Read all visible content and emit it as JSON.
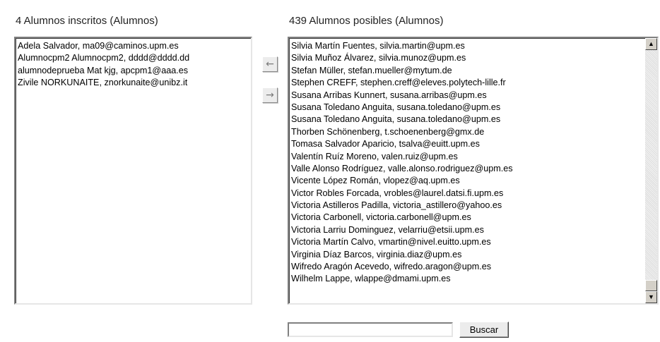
{
  "enrolled": {
    "heading": "4 Alumnos inscritos (Alumnos)",
    "items": [
      "Adela Salvador, ma09@caminos.upm.es",
      "Alumnocpm2 Alumnocpm2, dddd@dddd.dd",
      "alumnodeprueba Mat kjg, apcpm1@aaa.es",
      "Zivile NORKUNAITE, znorkunaite@unibz.it"
    ]
  },
  "candidates": {
    "heading": "439 Alumnos posibles (Alumnos)",
    "items": [
      "Silvia Martín Fuentes, silvia.martin@upm.es",
      "Silvia Muñoz Álvarez, silvia.munoz@upm.es",
      "Stefan Müller, stefan.mueller@mytum.de",
      "Stephen CREFF, stephen.creff@eleves.polytech-lille.fr",
      "Susana Arribas Kunnert, susana.arribas@upm.es",
      "Susana Toledano Anguita, susana.toledano@upm.es",
      "Susana Toledano Anguita, susana.toledano@upm.es",
      "Thorben Schönenberg, t.schoenenberg@gmx.de",
      "Tomasa Salvador Aparicio, tsalva@euitt.upm.es",
      "Valentín Ruíz Moreno, valen.ruiz@upm.es",
      "Valle Alonso Rodríguez, valle.alonso.rodriguez@upm.es",
      "Vicente López Román, vlopez@aq.upm.es",
      "Victor Robles Forcada, vrobles@laurel.datsi.fi.upm.es",
      "Victoria Astilleros Padilla, victoria_astillero@yahoo.es",
      "Victoria Carbonell, victoria.carbonell@upm.es",
      "Victoria Larriu Dominguez, velarriu@etsii.upm.es",
      "Victoria Martín Calvo, vmartin@nivel.euitto.upm.es",
      "Virginia Díaz Barcos, virginia.diaz@upm.es",
      "Wifredo Aragón Acevedo, wifredo.aragon@upm.es",
      "Wilhelm Lappe, wlappe@dmami.upm.es"
    ],
    "scroll_position": 1.0
  },
  "controls": {
    "add_arrow": "←",
    "remove_arrow": "→",
    "search_value": "",
    "search_label": "Buscar"
  },
  "icons": {
    "add": "arrow-left-icon",
    "remove": "arrow-right-icon",
    "scroll_up": "triangle-up-icon",
    "scroll_down": "triangle-down-icon"
  },
  "colors": {
    "button_face": "#ececec",
    "scrollbar_face": "#d4d0c8",
    "arrow_glyph": "#7a7a7a"
  }
}
